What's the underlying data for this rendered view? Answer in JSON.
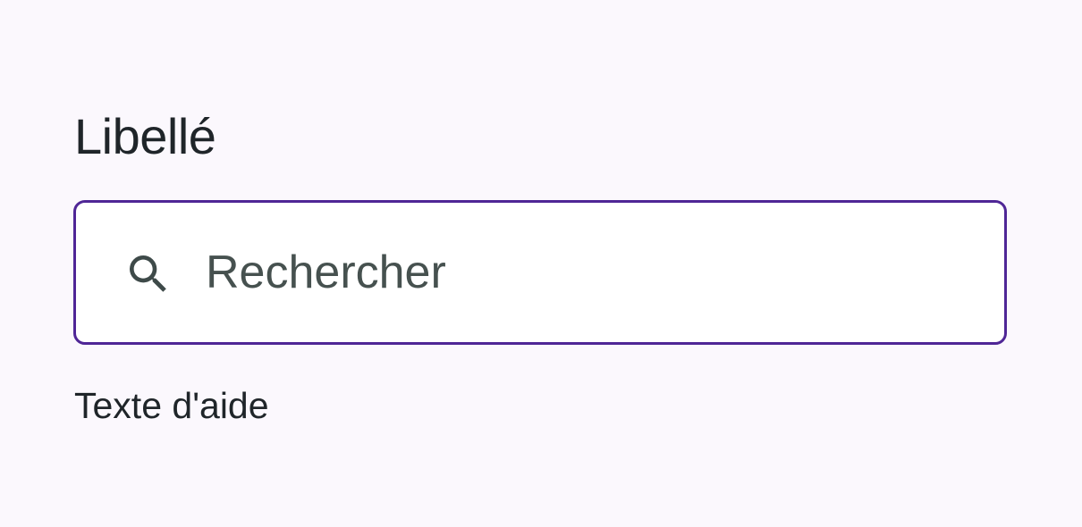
{
  "field": {
    "label": "Libellé",
    "placeholder": "Rechercher",
    "value": "",
    "helper_text": "Texte d'aide",
    "icon": "search-icon"
  },
  "colors": {
    "background": "#fbf8fd",
    "border_focus": "#4f2696",
    "label_text": "#1f2529",
    "placeholder_text": "#46514f",
    "icon": "#3e4a49"
  }
}
